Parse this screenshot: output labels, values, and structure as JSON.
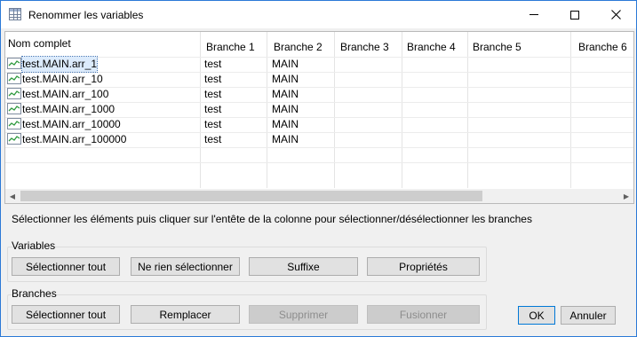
{
  "window": {
    "title": "Renommer les variables",
    "icon": "table-icon"
  },
  "grid": {
    "columns": [
      "Nom complet",
      "Branche 1",
      "Branche 2",
      "Branche 3",
      "Branche 4",
      "Branche 5",
      "Branche 6"
    ],
    "rows": [
      {
        "name": "test.MAIN.arr_1",
        "b1": "test",
        "b2": "MAIN"
      },
      {
        "name": "test.MAIN.arr_10",
        "b1": "test",
        "b2": "MAIN"
      },
      {
        "name": "test.MAIN.arr_100",
        "b1": "test",
        "b2": "MAIN"
      },
      {
        "name": "test.MAIN.arr_1000",
        "b1": "test",
        "b2": "MAIN"
      },
      {
        "name": "test.MAIN.arr_10000",
        "b1": "test",
        "b2": "MAIN"
      },
      {
        "name": "test.MAIN.arr_100000",
        "b1": "test",
        "b2": "MAIN"
      }
    ],
    "row_icon": "signal-chart-icon"
  },
  "instruction": "Sélectionner les éléments puis cliquer sur l'entête de la colonne pour sélectionner/désélectionner les branches",
  "variables": {
    "label": "Variables",
    "select_all": "Sélectionner tout",
    "select_none": "Ne rien sélectionner",
    "suffix": "Suffixe",
    "properties": "Propriétés"
  },
  "branches": {
    "label": "Branches",
    "select_all": "Sélectionner tout",
    "replace": "Remplacer",
    "delete": "Supprimer",
    "merge": "Fusionner"
  },
  "dialog": {
    "ok": "OK",
    "cancel": "Annuler"
  },
  "colors": {
    "accent": "#0078d7",
    "selection": "#dcebfc"
  }
}
